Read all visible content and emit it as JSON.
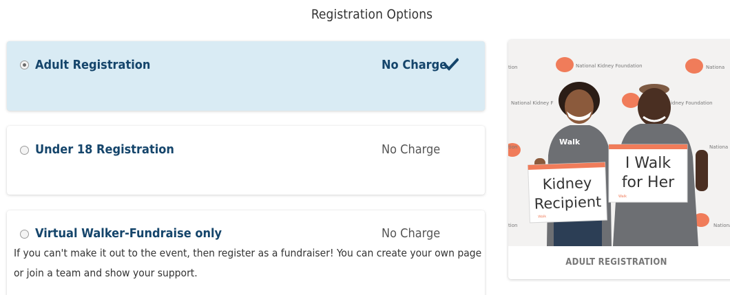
{
  "page": {
    "title": "Registration Options"
  },
  "options": [
    {
      "label": "Adult Registration",
      "price": "No Charge",
      "selected": true,
      "icon": "check-icon"
    },
    {
      "label": "Under 18 Registration",
      "price": "No Charge",
      "selected": false
    },
    {
      "label": "Virtual Walker-Fundraise only",
      "price": "No Charge",
      "selected": false,
      "description": "If you can't make it out to the event, then register as a fundraiser! You can create your own page or join a team and show your support."
    }
  ],
  "card": {
    "caption": "ADULT REGISTRATION",
    "photo": {
      "backdrop_text": "National Kidney Foundation",
      "sign_left": [
        "Kidney",
        "Recipient"
      ],
      "sign_right": [
        "I Walk",
        "for Her"
      ]
    }
  },
  "colors": {
    "selected_bg": "#d9ebf4",
    "label": "#15456b",
    "kidney_orange": "#f07c5a"
  }
}
